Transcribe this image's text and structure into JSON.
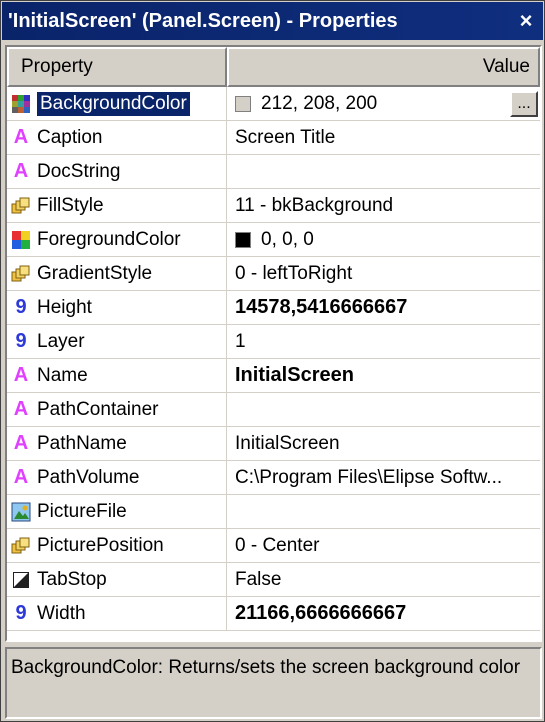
{
  "window": {
    "title": "'InitialScreen' (Panel.Screen) - Properties",
    "close_glyph": "×"
  },
  "header": {
    "property": "Property",
    "value": "Value"
  },
  "rows": [
    {
      "icon": "color-grid-icon",
      "name": "BackgroundColor",
      "value": "212, 208, 200",
      "swatch": "#d4d0c8",
      "selected": true,
      "ellipsis": "..."
    },
    {
      "icon": "string-a-icon",
      "name": "Caption",
      "value": "Screen Title"
    },
    {
      "icon": "string-a-icon",
      "name": "DocString",
      "value": ""
    },
    {
      "icon": "enum-icon",
      "name": "FillStyle",
      "value": "11 - bkBackground"
    },
    {
      "icon": "color-palette-icon",
      "name": "ForegroundColor",
      "value": "0, 0, 0",
      "swatch": "#000000"
    },
    {
      "icon": "enum-icon",
      "name": "GradientStyle",
      "value": "0 - leftToRight"
    },
    {
      "icon": "number-9-icon",
      "name": "Height",
      "value": "14578,5416666667",
      "bold": true
    },
    {
      "icon": "number-9-icon",
      "name": "Layer",
      "value": "1"
    },
    {
      "icon": "string-a-icon",
      "name": "Name",
      "value": "InitialScreen",
      "bold": true
    },
    {
      "icon": "string-a-icon",
      "name": "PathContainer",
      "value": ""
    },
    {
      "icon": "string-a-icon",
      "name": "PathName",
      "value": "InitialScreen"
    },
    {
      "icon": "string-a-icon",
      "name": "PathVolume",
      "value": "C:\\Program Files\\Elipse Softw..."
    },
    {
      "icon": "picture-icon",
      "name": "PictureFile",
      "value": ""
    },
    {
      "icon": "enum-icon",
      "name": "PicturePosition",
      "value": "0 - Center"
    },
    {
      "icon": "boolean-icon",
      "name": "TabStop",
      "value": "False"
    },
    {
      "icon": "number-9-icon",
      "name": "Width",
      "value": "21166,6666666667",
      "bold": true
    }
  ],
  "description": "BackgroundColor: Returns/sets the screen background color",
  "colors": {
    "title_bg": "#0a246a",
    "window_bg": "#d4d0c8",
    "string_icon": "#e040ff",
    "number_icon": "#2d3ad8"
  }
}
